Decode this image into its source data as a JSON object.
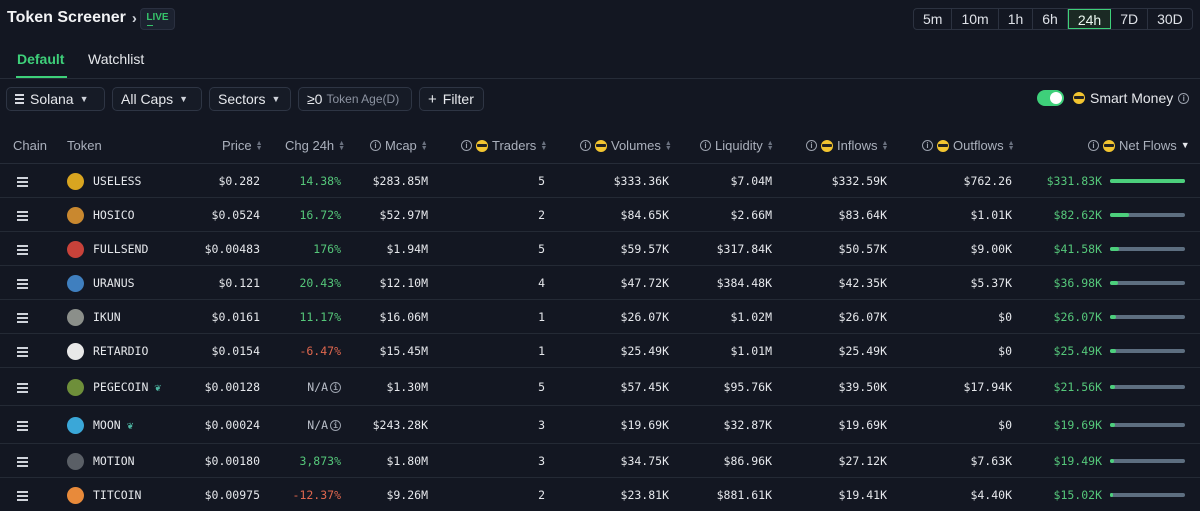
{
  "header": {
    "title": "Token Screener",
    "live_label": "LIVE"
  },
  "timeframes": [
    {
      "label": "5m",
      "active": false
    },
    {
      "label": "10m",
      "active": false
    },
    {
      "label": "1h",
      "active": false
    },
    {
      "label": "6h",
      "active": false
    },
    {
      "label": "24h",
      "active": true
    },
    {
      "label": "7D",
      "active": false
    },
    {
      "label": "30D",
      "active": false
    }
  ],
  "tabs": [
    {
      "label": "Default",
      "active": true
    },
    {
      "label": "Watchlist",
      "active": false
    }
  ],
  "filters": {
    "chain": "Solana",
    "caps": "All Caps",
    "sectors": "Sectors",
    "age_value": "≥0",
    "age_label": "Token Age(D)",
    "filter": "Filter",
    "smart_money": "Smart Money",
    "smart_money_on": true
  },
  "columns": {
    "chain": "Chain",
    "token": "Token",
    "price": "Price",
    "chg": "Chg 24h",
    "mcap": "Mcap",
    "traders": "Traders",
    "volumes": "Volumes",
    "liquidity": "Liquidity",
    "inflows": "Inflows",
    "outflows": "Outflows",
    "netflows": "Net Flows"
  },
  "colors": {
    "accent": "#3ed07a",
    "positive": "#55c77a",
    "negative": "#e0674e",
    "bar": "#4ccf7c"
  },
  "rows": [
    {
      "name": "USELESS",
      "price": "$0.282",
      "chg": "14.38%",
      "chg_dir": "up",
      "mcap": "$283.85M",
      "traders": "5",
      "volumes": "$333.36K",
      "liquidity": "$7.04M",
      "inflows": "$332.59K",
      "outflows": "$762.26",
      "netflows": "$331.83K",
      "net_fraction": 1.0,
      "avatar": "#d9a520",
      "leaf": false
    },
    {
      "name": "HOSICO",
      "price": "$0.0524",
      "chg": "16.72%",
      "chg_dir": "up",
      "mcap": "$52.97M",
      "traders": "2",
      "volumes": "$84.65K",
      "liquidity": "$2.66M",
      "inflows": "$83.64K",
      "outflows": "$1.01K",
      "netflows": "$82.62K",
      "net_fraction": 0.25,
      "avatar": "#c9882f",
      "leaf": false
    },
    {
      "name": "FULLSEND",
      "price": "$0.00483",
      "chg": "176%",
      "chg_dir": "up",
      "mcap": "$1.94M",
      "traders": "5",
      "volumes": "$59.57K",
      "liquidity": "$317.84K",
      "inflows": "$50.57K",
      "outflows": "$9.00K",
      "netflows": "$41.58K",
      "net_fraction": 0.125,
      "avatar": "#c8423a",
      "leaf": false
    },
    {
      "name": "URANUS",
      "price": "$0.121",
      "chg": "20.43%",
      "chg_dir": "up",
      "mcap": "$12.10M",
      "traders": "4",
      "volumes": "$47.72K",
      "liquidity": "$384.48K",
      "inflows": "$42.35K",
      "outflows": "$5.37K",
      "netflows": "$36.98K",
      "net_fraction": 0.11,
      "avatar": "#3f7fbf",
      "leaf": false
    },
    {
      "name": "IKUN",
      "price": "$0.0161",
      "chg": "11.17%",
      "chg_dir": "up",
      "mcap": "$16.06M",
      "traders": "1",
      "volumes": "$26.07K",
      "liquidity": "$1.02M",
      "inflows": "$26.07K",
      "outflows": "$0",
      "netflows": "$26.07K",
      "net_fraction": 0.08,
      "avatar": "#8b8f8a",
      "leaf": false
    },
    {
      "name": "RETARDIO",
      "price": "$0.0154",
      "chg": "-6.47%",
      "chg_dir": "down",
      "mcap": "$15.45M",
      "traders": "1",
      "volumes": "$25.49K",
      "liquidity": "$1.01M",
      "inflows": "$25.49K",
      "outflows": "$0",
      "netflows": "$25.49K",
      "net_fraction": 0.077,
      "avatar": "#e8e8e8",
      "leaf": false
    },
    {
      "name": "PEGECOIN",
      "price": "$0.00128",
      "chg": "N/A",
      "chg_dir": "na",
      "mcap": "$1.30M",
      "traders": "5",
      "volumes": "$57.45K",
      "liquidity": "$95.76K",
      "inflows": "$39.50K",
      "outflows": "$17.94K",
      "netflows": "$21.56K",
      "net_fraction": 0.065,
      "avatar": "#6e8f3a",
      "leaf": true
    },
    {
      "name": "MOON",
      "price": "$0.00024",
      "chg": "N/A",
      "chg_dir": "na",
      "mcap": "$243.28K",
      "traders": "3",
      "volumes": "$19.69K",
      "liquidity": "$32.87K",
      "inflows": "$19.69K",
      "outflows": "$0",
      "netflows": "$19.69K",
      "net_fraction": 0.06,
      "avatar": "#3aa7d8",
      "leaf": true
    },
    {
      "name": "MOTION",
      "price": "$0.00180",
      "chg": "3,873%",
      "chg_dir": "up",
      "mcap": "$1.80M",
      "traders": "3",
      "volumes": "$34.75K",
      "liquidity": "$86.96K",
      "inflows": "$27.12K",
      "outflows": "$7.63K",
      "netflows": "$19.49K",
      "net_fraction": 0.058,
      "avatar": "#5a5f66",
      "leaf": false
    },
    {
      "name": "TITCOIN",
      "price": "$0.00975",
      "chg": "-12.37%",
      "chg_dir": "down",
      "mcap": "$9.26M",
      "traders": "2",
      "volumes": "$23.81K",
      "liquidity": "$881.61K",
      "inflows": "$19.41K",
      "outflows": "$4.40K",
      "netflows": "$15.02K",
      "net_fraction": 0.045,
      "avatar": "#e88a3a",
      "leaf": false
    }
  ]
}
